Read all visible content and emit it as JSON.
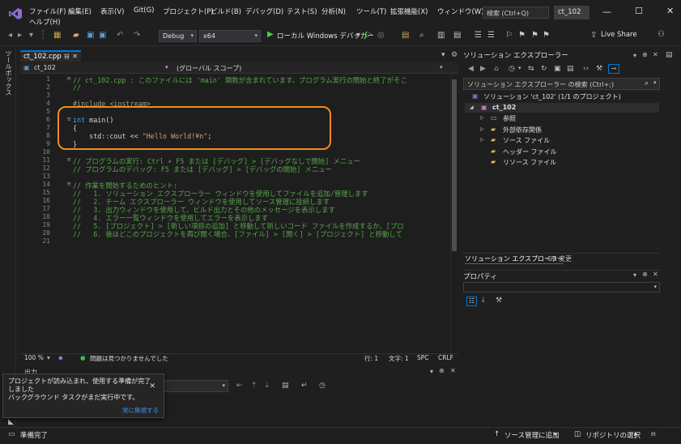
{
  "menu": {
    "items": [
      "ファイル(F)",
      "編集(E)",
      "表示(V)",
      "Git(G)",
      "プロジェクト(P)",
      "ビルド(B)",
      "デバッグ(D)",
      "テスト(S)",
      "分析(N)",
      "ツール(T)",
      "拡張機能(X)",
      "ウィンドウ(W)"
    ],
    "help": "ヘルプ(H)",
    "search_placeholder": "検索 (Ctrl+Q)",
    "solution_name": "ct_102"
  },
  "toolbar": {
    "config": "Debug",
    "platform": "x64",
    "run_label": "ローカル Windows デバッガー",
    "live_share": "Live Share"
  },
  "left_strip": {
    "label": "ツールボックス"
  },
  "editor": {
    "tab_title": "ct_102.cpp",
    "nav_project": "ct_102",
    "nav_scope": "(グローバル スコープ)",
    "line_numbers": [
      "1",
      "2",
      "3",
      "4",
      "5",
      "6",
      "7",
      "8",
      "9",
      "10",
      "11",
      "12",
      "13",
      "14",
      "15",
      "16",
      "17",
      "18",
      "19",
      "20",
      "21"
    ],
    "lines": {
      "l1": "// ct_102.cpp : このファイルには 'main' 関数が含まれています。プログラム実行の開始と終了がそこ",
      "l2": "//",
      "l4": "#include <iostream>",
      "l6_kw": "int",
      "l6_rest": " main()",
      "l7": "{",
      "l8_a": "    std::cout << ",
      "l8_str": "\"Hello World!¥n\"",
      "l8_b": ";",
      "l9": "}",
      "l11": "// プログラムの実行: Ctrl + F5 または [デバッグ] > [デバッグなしで開始] メニュー",
      "l12": "// プログラムのデバッグ: F5 または [デバッグ] > [デバッグの開始] メニュー",
      "l14": "// 作業を開始するためのヒント:",
      "l15": "//   1. ソリューション エクスプローラー ウィンドウを使用してファイルを追加/管理します",
      "l16": "//   2. チーム エクスプローラー ウィンドウを使用してソース管理に接続します",
      "l17": "//   3. 出力ウィンドウを使用して、ビルド出力とその他のメッセージを表示します",
      "l18": "//   4. エラー一覧ウィンドウを使用してエラーを表示します",
      "l19": "//   5. [プロジェクト] > [新しい項目の追加] と移動して新しいコード ファイルを作成するか、[プロ",
      "l20": "//   6. 後ほどこのプロジェクトを再び開く場合、[ファイル] > [開く] > [プロジェクト] と移動して"
    }
  },
  "editor_status": {
    "zoom": "100 %",
    "issues": "問題は見つかりませんでした",
    "line": "行: 1",
    "char": "文字: 1",
    "spc": "SPC",
    "crlf": "CRLF"
  },
  "output": {
    "title": "出力"
  },
  "toast": {
    "line1": "プロジェクトが読み込まれ、使用する準備が完了",
    "line2": "しました",
    "line3": "バックグラウンド タスクがまだ実行中です。",
    "link": "常に無視する"
  },
  "solution_explorer": {
    "title": "ソリューション エクスプローラー",
    "search_placeholder": "ソリューション エクスプローラー の検索 (Ctrl+;)",
    "solution_label": "ソリューション 'ct_102' (1/1 のプロジェクト)",
    "project": "ct_102",
    "nodes": [
      "参照",
      "外部依存関係",
      "ソース ファイル",
      "ヘッダー ファイル",
      "リソース ファイル"
    ],
    "tab_active": "ソリューション エクスプローラー",
    "tab_git": "Git 変更"
  },
  "properties": {
    "title": "プロパティ"
  },
  "statusbar": {
    "ready": "準備完了",
    "source_control": "ソース管理に追加",
    "repository": "リポジトリの選択"
  },
  "colors": {
    "accent": "#0078d4",
    "highlight_box": "#f08a24",
    "comment": "#57a64a",
    "keyword": "#569cd6",
    "string": "#d69d85"
  }
}
